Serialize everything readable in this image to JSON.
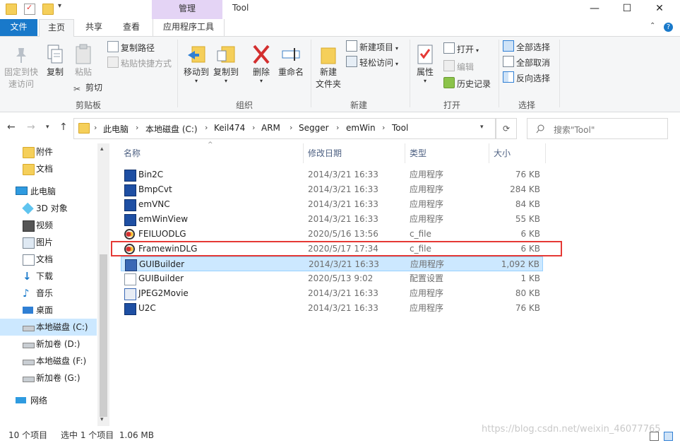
{
  "title_bar": {
    "contextual_tab": "管理",
    "window_title": "Tool",
    "minimize": "—",
    "maximize": "☐",
    "close": "✕"
  },
  "ribbon_tabs": [
    "文件",
    "主页",
    "共享",
    "查看",
    "应用程序工具"
  ],
  "ribbon": {
    "clipboard": {
      "pin_label": "固定到快",
      "pin_label2": "速访问",
      "copy": "复制",
      "paste": "粘贴",
      "copy_path": "复制路径",
      "paste_shortcut": "粘贴快捷方式",
      "cut": "剪切",
      "group": "剪贴板"
    },
    "organize": {
      "move_to": "移动到",
      "copy_to": "复制到",
      "delete": "删除",
      "rename": "重命名",
      "group": "组织"
    },
    "new": {
      "new_folder": "新建",
      "new_folder2": "文件夹",
      "new_item": "新建项目",
      "easy_access": "轻松访问",
      "group": "新建"
    },
    "open": {
      "properties": "属性",
      "open": "打开",
      "edit": "编辑",
      "history": "历史记录",
      "group": "打开"
    },
    "select": {
      "select_all": "全部选择",
      "select_none": "全部取消",
      "invert": "反向选择",
      "group": "选择"
    }
  },
  "address": {
    "crumbs": [
      "此电脑",
      "本地磁盘 (C:)",
      "Keil474",
      "ARM",
      "Segger",
      "emWin",
      "Tool"
    ],
    "search_placeholder": "搜索\"Tool\""
  },
  "nav_pane": [
    {
      "label": "附件",
      "icon": "folder-icon"
    },
    {
      "label": "文档",
      "icon": "folder-icon"
    },
    {
      "label": "此电脑",
      "icon": "computer-icon"
    },
    {
      "label": "3D 对象",
      "icon": "3d-objects-icon"
    },
    {
      "label": "视频",
      "icon": "video-icon"
    },
    {
      "label": "图片",
      "icon": "pictures-icon"
    },
    {
      "label": "文档",
      "icon": "documents-icon"
    },
    {
      "label": "下载",
      "icon": "download-icon"
    },
    {
      "label": "音乐",
      "icon": "music-icon"
    },
    {
      "label": "桌面",
      "icon": "desktop-icon"
    },
    {
      "label": "本地磁盘 (C:)",
      "icon": "drive-c-icon"
    },
    {
      "label": "新加卷 (D:)",
      "icon": "drive-icon"
    },
    {
      "label": "本地磁盘 (F:)",
      "icon": "drive-icon"
    },
    {
      "label": "新加卷 (G:)",
      "icon": "drive-icon"
    },
    {
      "label": "网络",
      "icon": "network-icon"
    }
  ],
  "columns": {
    "name": "名称",
    "date": "修改日期",
    "type": "类型",
    "size": "大小"
  },
  "files": [
    {
      "name": "Bin2C",
      "date": "2014/3/21 16:33",
      "type": "应用程序",
      "size": "76 KB",
      "icon": "bin2c-app-icon"
    },
    {
      "name": "BmpCvt",
      "date": "2014/3/21 16:33",
      "type": "应用程序",
      "size": "284 KB",
      "icon": "bmpcvt-app-icon"
    },
    {
      "name": "emVNC",
      "date": "2014/3/21 16:33",
      "type": "应用程序",
      "size": "84 KB",
      "icon": "emvnc-app-icon"
    },
    {
      "name": "emWinView",
      "date": "2014/3/21 16:33",
      "type": "应用程序",
      "size": "55 KB",
      "icon": "emwinview-app-icon"
    },
    {
      "name": "FEILUODLG",
      "date": "2020/5/16 13:56",
      "type": "c_file",
      "size": "6 KB",
      "icon": "c-file-icon"
    },
    {
      "name": "FramewinDLG",
      "date": "2020/5/17 17:34",
      "type": "c_file",
      "size": "6 KB",
      "icon": "c-file-icon"
    },
    {
      "name": "GUIBuilder",
      "date": "2014/3/21 16:33",
      "type": "应用程序",
      "size": "1,092 KB",
      "icon": "guibuilder-app-icon"
    },
    {
      "name": "GUIBuilder",
      "date": "2020/5/13 9:02",
      "type": "配置设置",
      "size": "1 KB",
      "icon": "config-file-icon"
    },
    {
      "name": "JPEG2Movie",
      "date": "2014/3/21 16:33",
      "type": "应用程序",
      "size": "80 KB",
      "icon": "jpeg2movie-app-icon"
    },
    {
      "name": "U2C",
      "date": "2014/3/21 16:33",
      "type": "应用程序",
      "size": "76 KB",
      "icon": "u2c-app-icon"
    }
  ],
  "selected_file_index": 6,
  "status": {
    "count": "10 个项目",
    "selection": "选中 1 个项目  1.06 MB"
  },
  "watermark": "https://blog.csdn.net/weixin_46077765",
  "colors": {
    "accent": "#1979ca",
    "selection": "#cce8ff",
    "highlight_box": "#e53935",
    "contextual_tab": "#e4d4f5"
  }
}
